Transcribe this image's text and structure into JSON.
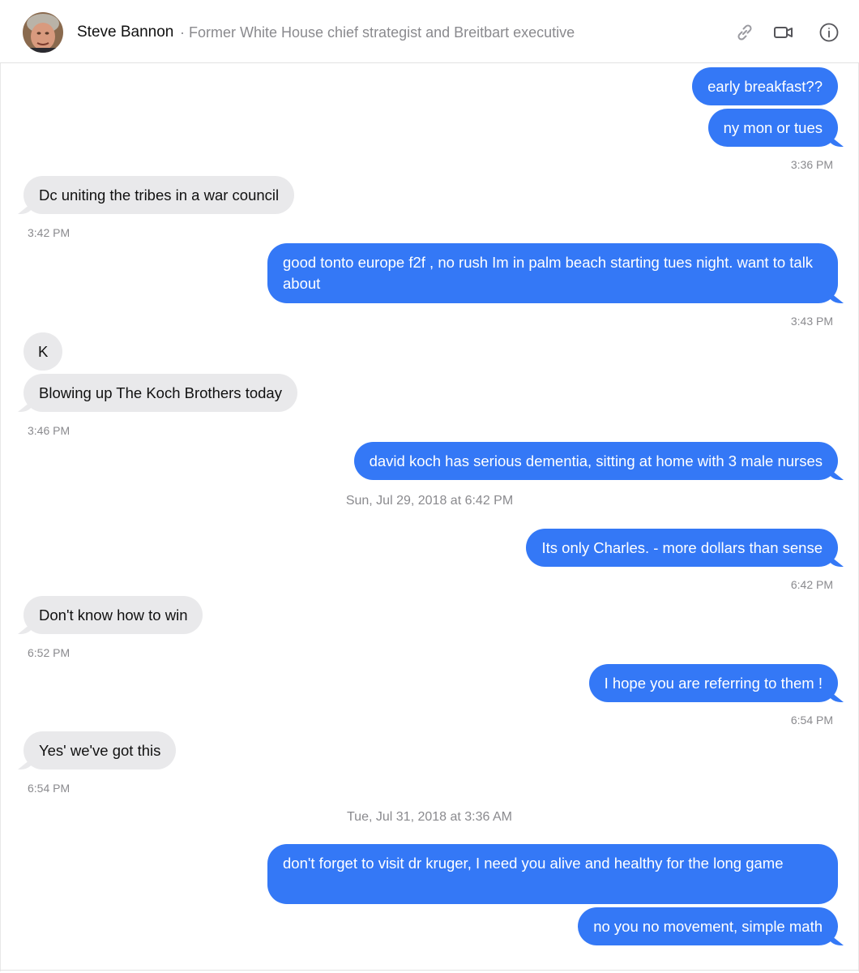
{
  "header": {
    "name": "Steve Bannon",
    "subtitle": "· Former White House chief strategist and Breitbart executive",
    "icons": [
      "link-icon",
      "video-camera-icon",
      "info-icon"
    ]
  },
  "messages": [
    {
      "dir": "out",
      "text": "early breakfast??"
    },
    {
      "dir": "out",
      "text": "ny mon or tues"
    },
    {
      "time": "3:36 PM"
    },
    {
      "dir": "in",
      "text": "Dc uniting the tribes in a war council"
    },
    {
      "time": "3:42 PM"
    },
    {
      "dir": "out",
      "text": "good tonto europe f2f , no rush Im in palm beach starting tues night. want to talk about"
    },
    {
      "time": "3:43 PM"
    },
    {
      "dir": "in",
      "text": "K"
    },
    {
      "dir": "in",
      "text": "Blowing up The Koch Brothers today"
    },
    {
      "time": "3:46 PM"
    },
    {
      "dir": "out",
      "text": "david koch has serious dementia, sitting at home with 3 male nurses"
    },
    {
      "day": "Sun, Jul 29, 2018 at 6:42 PM"
    },
    {
      "dir": "out",
      "text": "Its only Charles. - more dollars than sense"
    },
    {
      "time": "6:42 PM"
    },
    {
      "dir": "in",
      "text": "Don't know how to win"
    },
    {
      "time": "6:52 PM"
    },
    {
      "dir": "out",
      "text": "I hope you are referring to them !"
    },
    {
      "time": "6:54 PM"
    },
    {
      "dir": "in",
      "text": "Yes' we've got this"
    },
    {
      "time": "6:54 PM"
    },
    {
      "day": "Tue, Jul 31, 2018 at 3:36 AM"
    },
    {
      "dir": "out",
      "text": "don't forget to visit dr kruger, I need you alive and healthy for the long game"
    },
    {
      "dir": "out",
      "text": "no you no movement, simple math"
    }
  ],
  "colors": {
    "outgoing": "#3478f6",
    "incoming": "#e9e9eb",
    "meta": "#8a8a8e"
  }
}
